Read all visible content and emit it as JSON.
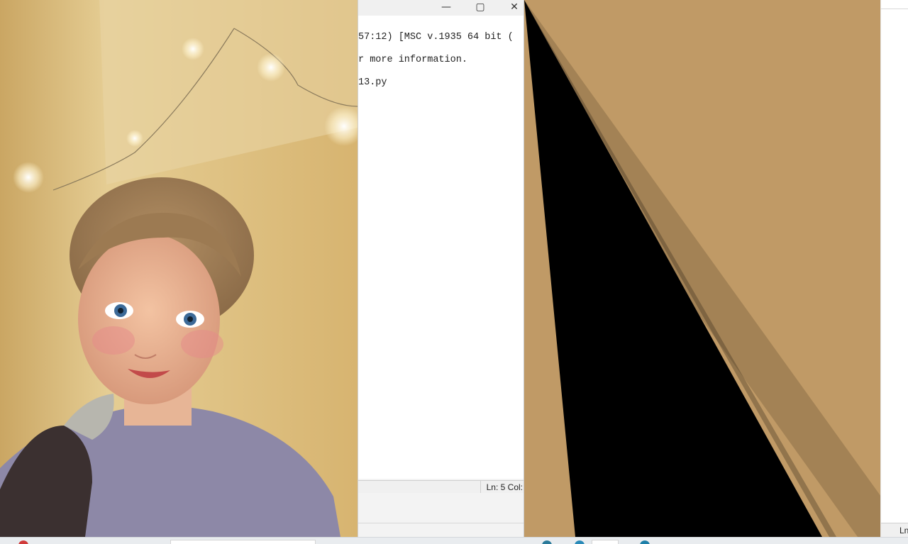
{
  "shell_window": {
    "lines": [
      "57:12) [MSC v.1935 64 bit (",
      "r more information.",
      "13.py"
    ],
    "status": "Ln: 5  Col:",
    "controls": {
      "minimize": "—",
      "maximize": "▢",
      "close": "✕"
    }
  },
  "right_window": {
    "status": "Ln"
  },
  "canvas": {
    "background_color": "#c09a66",
    "shape_color": "#000000"
  },
  "icons": [
    "photo",
    "minimize-icon",
    "maximize-icon",
    "close-icon"
  ]
}
